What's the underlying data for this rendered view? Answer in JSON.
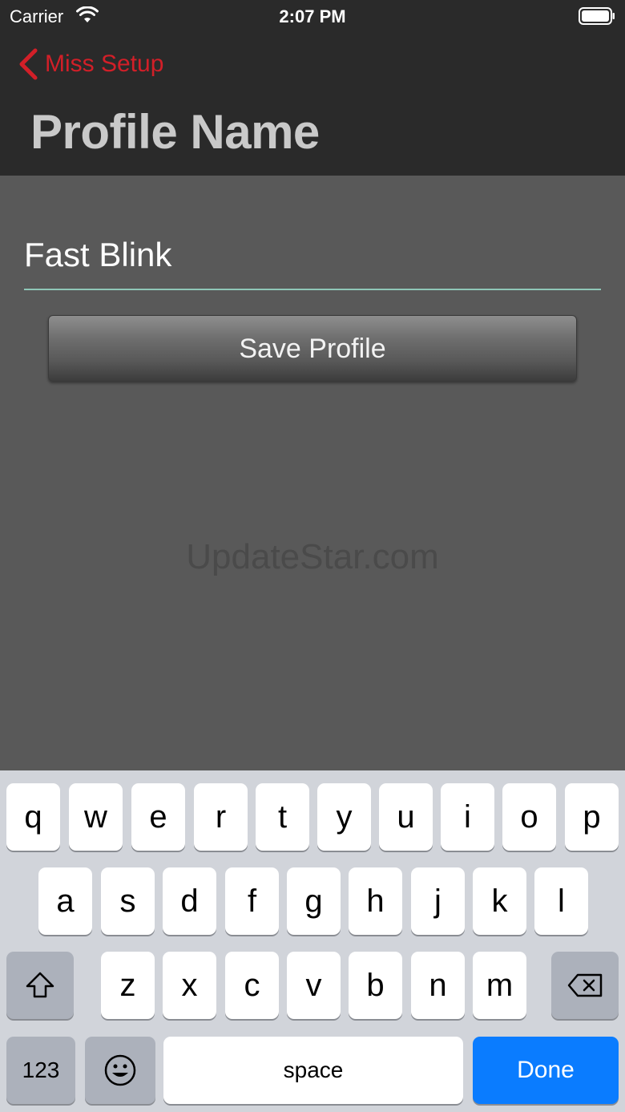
{
  "status_bar": {
    "carrier": "Carrier",
    "time": "2:07 PM"
  },
  "nav": {
    "back_label": "Miss Setup",
    "title": "Profile Name"
  },
  "form": {
    "name_value": "Fast Blink",
    "save_label": "Save Profile"
  },
  "watermark": "UpdateStar.com",
  "keyboard": {
    "row1": [
      "q",
      "w",
      "e",
      "r",
      "t",
      "y",
      "u",
      "i",
      "o",
      "p"
    ],
    "row2": [
      "a",
      "s",
      "d",
      "f",
      "g",
      "h",
      "j",
      "k",
      "l"
    ],
    "row3": [
      "z",
      "x",
      "c",
      "v",
      "b",
      "n",
      "m"
    ],
    "numbers_label": "123",
    "space_label": "space",
    "done_label": "Done"
  },
  "colors": {
    "accent": "#d21f28",
    "done": "#0a7cff",
    "underline": "#8fc7b8"
  }
}
